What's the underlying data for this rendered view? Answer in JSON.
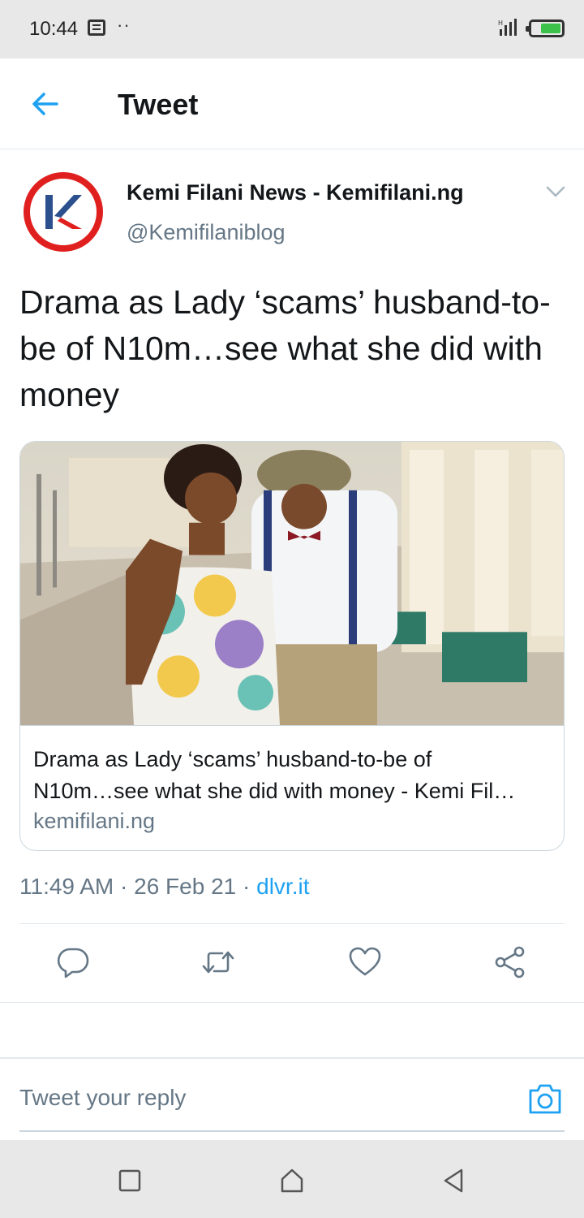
{
  "status_bar": {
    "time": "10:44",
    "dots": "··",
    "icons": [
      "notes-icon",
      "signal-icon",
      "battery-charging-icon"
    ],
    "battery_color": "#3cc24a"
  },
  "header": {
    "title": "Tweet",
    "back_icon": "arrow-left-icon",
    "accent": "#1da1f2"
  },
  "tweet": {
    "author_name": "Kemi Filani News - Kemifilani.ng",
    "author_handle": "@Kemifilaniblog",
    "avatar_letter": "K",
    "text": "Drama as Lady ‘scams’ husband-to-be of N10m…see what she did with money",
    "card": {
      "title_line1": "Drama as Lady ‘scams’ husband-to-be of",
      "title_line2": "N10m…see what she did with money - Kemi Fil…",
      "domain": "kemifilani.ng",
      "image_icon": "photo-couple-image"
    },
    "time": "11:49 AM",
    "separator": " · ",
    "date": "26 Feb 21",
    "source": "dlvr.it"
  },
  "actions": [
    {
      "name": "reply",
      "icon": "reply-icon"
    },
    {
      "name": "retweet",
      "icon": "retweet-icon"
    },
    {
      "name": "like",
      "icon": "heart-icon"
    },
    {
      "name": "share",
      "icon": "share-icon"
    }
  ],
  "reply": {
    "placeholder": "Tweet your reply",
    "camera_icon": "camera-icon"
  },
  "nav": {
    "icons": [
      "recent-apps-icon",
      "home-icon",
      "back-icon"
    ]
  }
}
